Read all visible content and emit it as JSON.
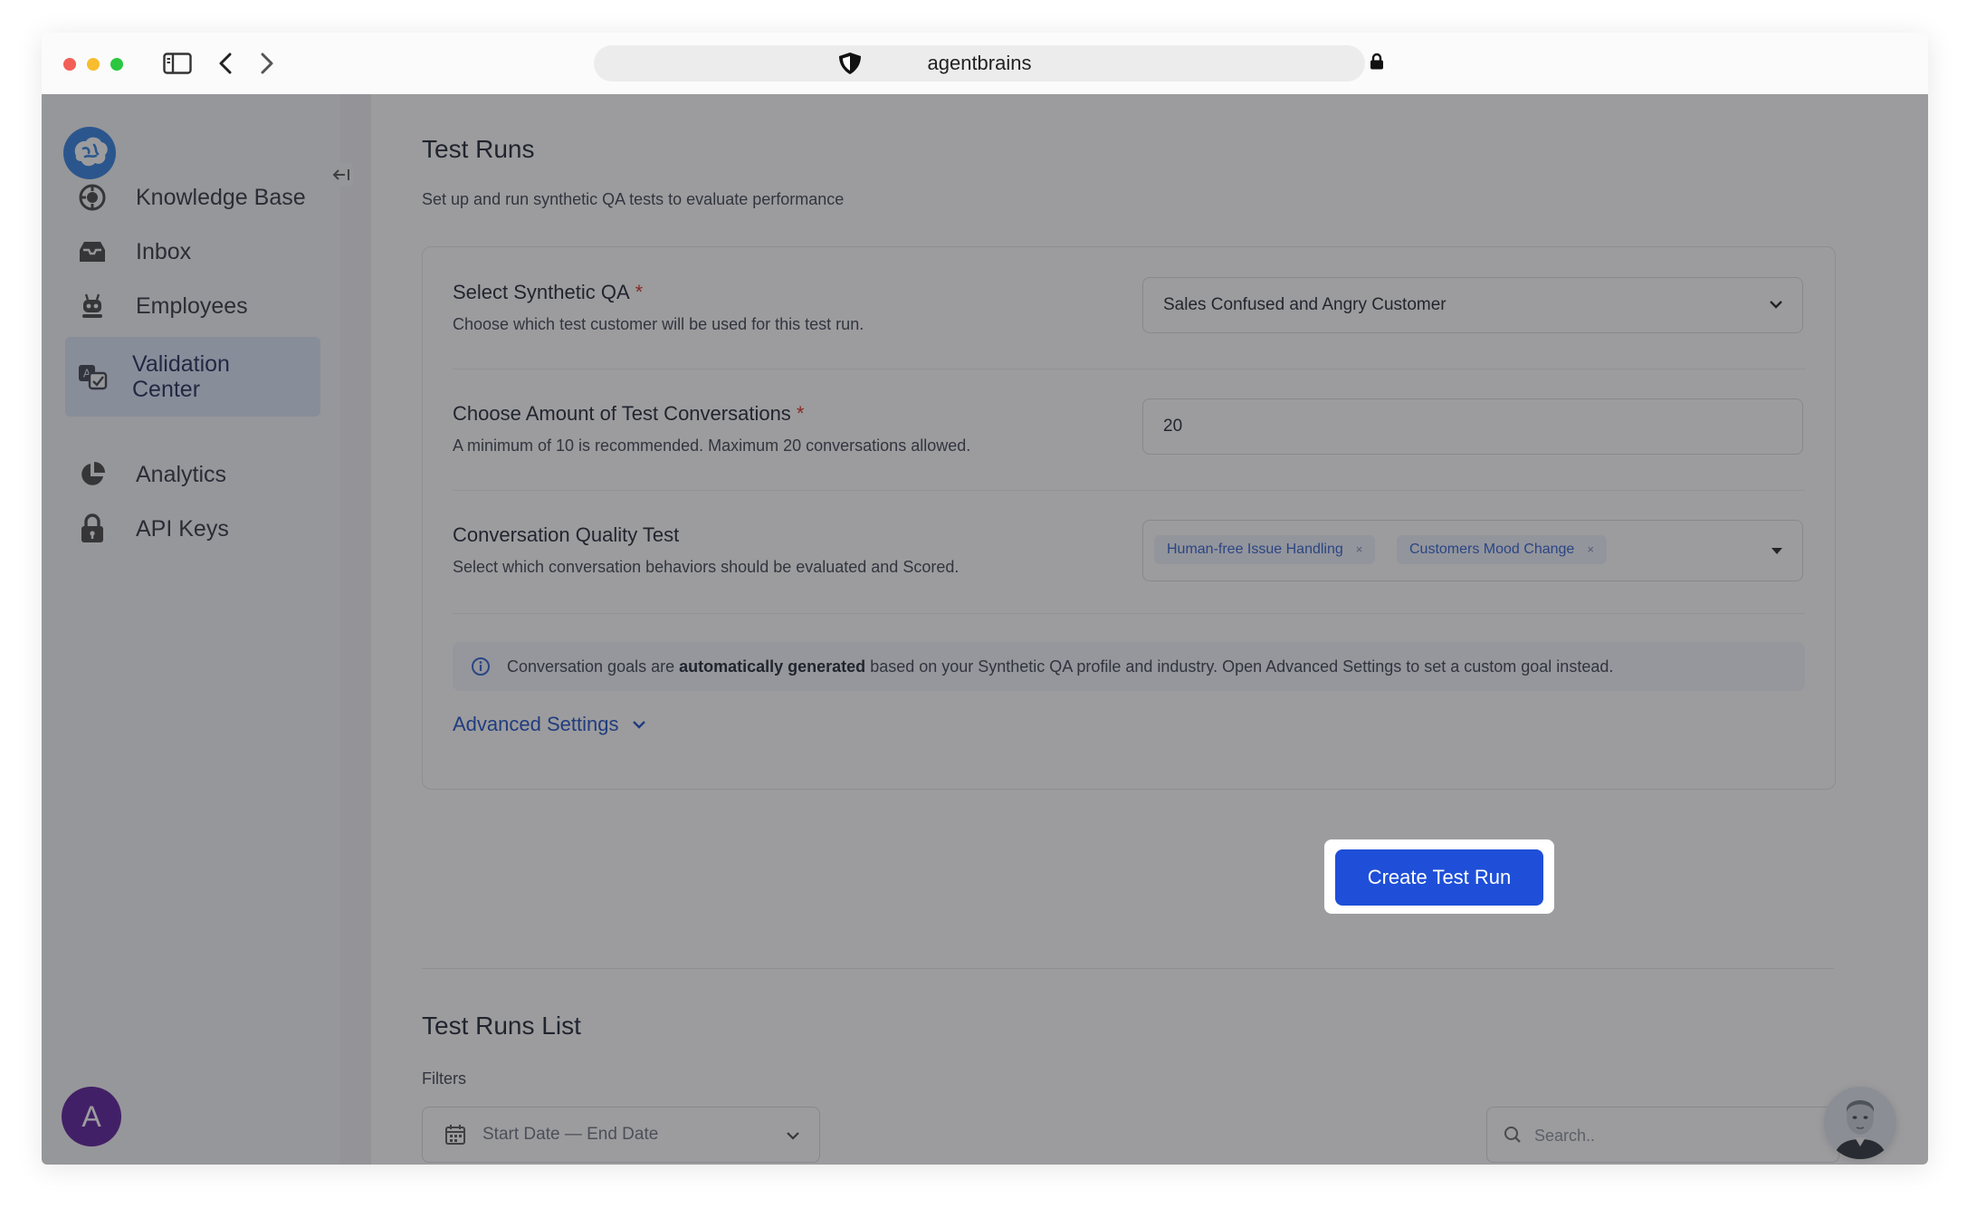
{
  "browser": {
    "url": "agentbrains"
  },
  "sidebar": {
    "items": [
      {
        "label": "Knowledge Base",
        "icon": "knowledge-base-icon"
      },
      {
        "label": "Inbox",
        "icon": "inbox-icon"
      },
      {
        "label": "Employees",
        "icon": "robot-icon"
      },
      {
        "label": "Validation\nCenter",
        "icon": "validation-icon",
        "active": true
      },
      {
        "label": "Analytics",
        "icon": "pie-chart-icon"
      },
      {
        "label": "API Keys",
        "icon": "lock-icon"
      }
    ],
    "avatar_initial": "A"
  },
  "page": {
    "title": "Test Runs",
    "subtitle": "Set up and run synthetic QA tests to evaluate performance"
  },
  "form": {
    "synthetic_qa": {
      "label": "Select Synthetic QA",
      "required_mark": "*",
      "help": "Choose which test customer will be used for this test run.",
      "value": "Sales Confused and Angry Customer"
    },
    "amount": {
      "label": "Choose Amount of Test Conversations",
      "required_mark": "*",
      "help": "A minimum of 10 is recommended. Maximum 20 conversations allowed.",
      "value": "20"
    },
    "quality": {
      "label": "Conversation Quality Test",
      "help": "Select which conversation behaviors should be evaluated and Scored.",
      "chips": [
        "Human-free Issue Handling",
        "Customers Mood Change"
      ],
      "chip_remove": "×"
    },
    "info": {
      "before": "Conversation goals are ",
      "bold": "automatically generated",
      "after": " based on your Synthetic QA profile and industry. Open Advanced Settings to set a custom goal instead."
    },
    "advanced_label": "Advanced Settings",
    "submit_label": "Create Test Run"
  },
  "list": {
    "title": "Test Runs List",
    "filters_label": "Filters",
    "date_placeholder": "Start Date — End Date",
    "search_placeholder": "Search.."
  },
  "colors": {
    "primary": "#1f4fd8",
    "required": "#d92d20",
    "chip_text": "#2e5fcf",
    "avatar": "#5a1a9a"
  }
}
